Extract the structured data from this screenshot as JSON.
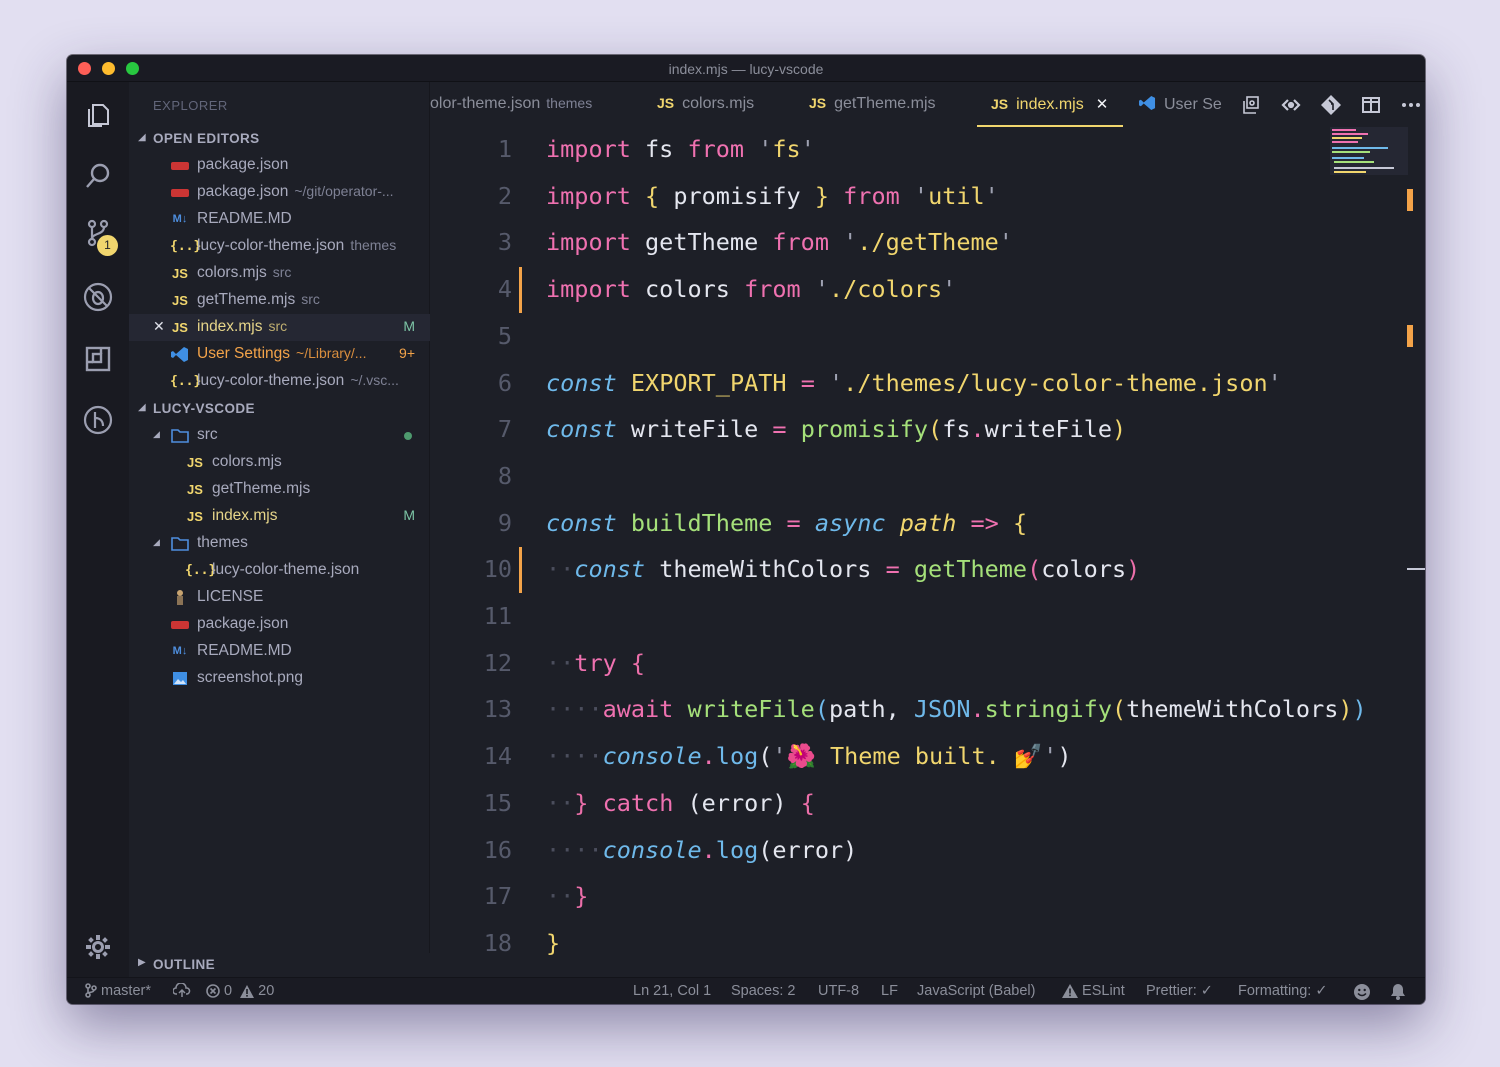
{
  "window": {
    "title": "index.mjs — lucy-vscode"
  },
  "explorer": {
    "title": "EXPLORER",
    "open_editors": {
      "label": "OPEN EDITORS",
      "items": [
        {
          "icon": "npm-icon",
          "name": "package.json",
          "detail": ""
        },
        {
          "icon": "npm-icon",
          "name": "package.json",
          "detail": "~/git/operator-..."
        },
        {
          "icon": "markdown-icon",
          "name": "README.MD",
          "detail": ""
        },
        {
          "icon": "json-icon",
          "name": "lucy-color-theme.json",
          "detail": "themes"
        },
        {
          "icon": "js-icon",
          "name": "colors.mjs",
          "detail": "src"
        },
        {
          "icon": "js-icon",
          "name": "getTheme.mjs",
          "detail": "src"
        },
        {
          "icon": "js-icon",
          "name": "index.mjs",
          "detail": "src",
          "status": "M"
        },
        {
          "icon": "vscode-icon",
          "name": "User Settings",
          "detail": "~/Library/...",
          "status": "9+"
        },
        {
          "icon": "json-icon",
          "name": "lucy-color-theme.json",
          "detail": "~/.vsc..."
        }
      ]
    },
    "workspace": {
      "label": "LUCY-VSCODE",
      "src": "src",
      "src_files": [
        "colors.mjs",
        "getTheme.mjs",
        "index.mjs"
      ],
      "src_index_status": "M",
      "themes": "themes",
      "themes_files": [
        "lucy-color-theme.json"
      ],
      "root_files": [
        "LICENSE",
        "package.json",
        "README.MD",
        "screenshot.png"
      ]
    },
    "outline": "OUTLINE"
  },
  "activity": {
    "scm_badge": "1"
  },
  "tabs": [
    {
      "name": "olor-theme.json",
      "detail": "themes",
      "icon": ""
    },
    {
      "name": "colors.mjs",
      "detail": "",
      "icon": "JS"
    },
    {
      "name": "getTheme.mjs",
      "detail": "",
      "icon": "JS"
    },
    {
      "name": "index.mjs",
      "detail": "",
      "icon": "JS",
      "active": true
    },
    {
      "name": "User Se",
      "detail": "",
      "icon": "vscode"
    }
  ],
  "icon_glyphs": {
    "js": "JS",
    "json": "{..}",
    "markdown": "M↓",
    "close": "✕",
    "tri_open": "◢",
    "tri_closed": "▶"
  },
  "editor": {
    "line_numbers": [
      "1",
      "2",
      "3",
      "4",
      "5",
      "6",
      "7",
      "8",
      "9",
      "10",
      "11",
      "12",
      "13",
      "14",
      "15",
      "16",
      "17",
      "18"
    ],
    "lines": [
      "import fs from 'fs'",
      "import { promisify } from 'util'",
      "import getTheme from './getTheme'",
      "import colors from './colors'",
      "",
      "const EXPORT_PATH = './themes/lucy-color-theme.json'",
      "const writeFile = promisify(fs.writeFile)",
      "",
      "const buildTheme = async path => {",
      "  const themeWithColors = getTheme(colors)",
      "",
      "  try {",
      "    await writeFile(path, JSON.stringify(themeWithColors))",
      "    console.log('🌺 Theme built. 💅')",
      "  } catch (error) {",
      "    console.log(error)",
      "  }",
      "}"
    ],
    "modified_lines": [
      4,
      10
    ]
  },
  "statusbar": {
    "branch": "master*",
    "errors": "0",
    "warnings": "20",
    "position": "Ln 21, Col 1",
    "spaces": "Spaces: 2",
    "encoding": "UTF-8",
    "eol": "LF",
    "language": "JavaScript (Babel)",
    "eslint": "ESLint",
    "prettier": "Prettier: ✓",
    "formatting": "Formatting: ✓"
  },
  "colors": {
    "background": "#1d1f27",
    "keyword": "#ef71b0",
    "string": "#f1d66e",
    "const": "#6fb9ea",
    "function": "#a5e07a",
    "modified": "#f3a349"
  }
}
